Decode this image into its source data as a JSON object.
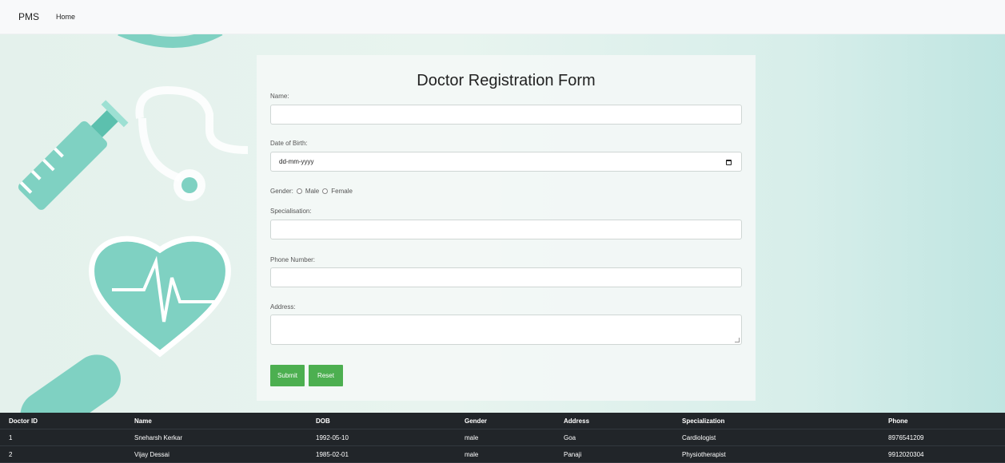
{
  "navbar": {
    "brand": "PMS",
    "links": [
      "Home"
    ]
  },
  "form": {
    "title": "Doctor Registration Form",
    "name": {
      "label": "Name:",
      "value": ""
    },
    "dob": {
      "label": "Date of Birth:",
      "placeholder": "dd-mm-yyyy"
    },
    "gender": {
      "label": "Gender:",
      "options": [
        "Male",
        "Female"
      ]
    },
    "specialisation": {
      "label": "Specialisation:",
      "value": ""
    },
    "phone": {
      "label": "Phone Number:",
      "value": ""
    },
    "address": {
      "label": "Address:",
      "value": ""
    },
    "buttons": {
      "submit": "Submit",
      "reset": "Reset"
    }
  },
  "table": {
    "headers": [
      "Doctor ID",
      "Name",
      "DOB",
      "Gender",
      "Address",
      "Specialization",
      "Phone"
    ],
    "rows": [
      [
        "1",
        "Sneharsh Kerkar",
        "1992-05-10",
        "male",
        "Goa",
        "Cardiologist",
        "8976541209"
      ],
      [
        "2",
        "Vijay Dessai",
        "1985-02-01",
        "male",
        "Panaji",
        "Physiotherapist",
        "9912020304"
      ]
    ]
  },
  "colors": {
    "accent": "#4caf50",
    "table_bg": "#212529",
    "illustration": "#7fd1c2"
  }
}
